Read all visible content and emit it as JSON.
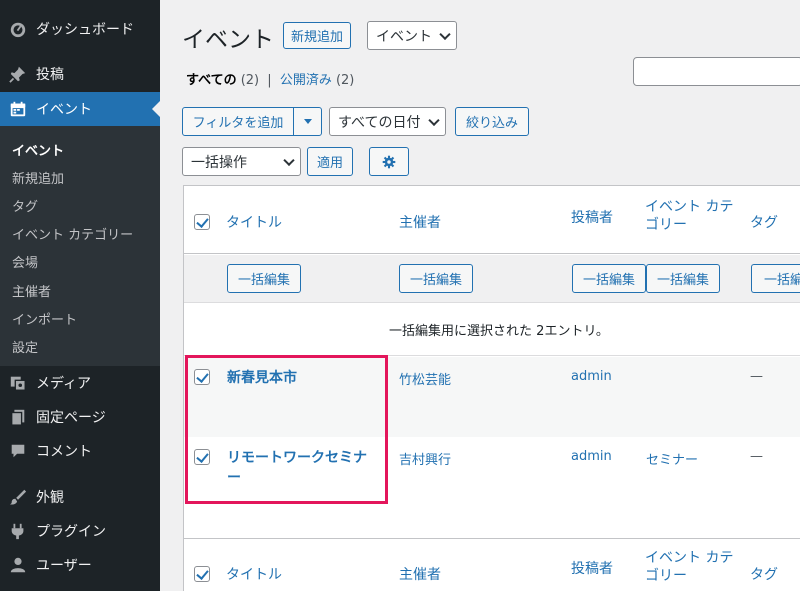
{
  "sidebar": {
    "dashboard": "ダッシュボード",
    "posts": "投稿",
    "events": "イベント",
    "submenu": [
      "イベント",
      "新規追加",
      "タグ",
      "イベント カテゴリー",
      "会場",
      "主催者",
      "インポート",
      "設定"
    ],
    "media": "メディア",
    "pages": "固定ページ",
    "comments": "コメント",
    "appearance": "外観",
    "plugins": "プラグイン",
    "users": "ユーザー"
  },
  "header": {
    "title": "イベント",
    "add_new": "新規追加",
    "type_select": "イベント"
  },
  "views": {
    "all_label": "すべての",
    "all_count": "(2)",
    "separator": "|",
    "published_label": "公開済み",
    "published_count": "(2)"
  },
  "filters": {
    "add_filter": "フィルタを追加",
    "date_select": "すべての日付",
    "filter_button": "絞り込み",
    "bulk_select": "一括操作",
    "apply": "適用"
  },
  "table": {
    "columns": {
      "title": "タイトル",
      "organizer": "主催者",
      "author": "投稿者",
      "category_line1": "イベント カテ",
      "category_line2": "ゴリー",
      "tags": "タグ"
    },
    "bulk_edit_label": "一括編集",
    "bulk_edit_cut": "一括編",
    "selection_notice": "一括編集用に選択された 2エントリ。",
    "rows": [
      {
        "title": "新春見本市",
        "organizer": "竹松芸能",
        "author": "admin",
        "category": "",
        "tags": "—"
      },
      {
        "title_line1": "リモートワークセミナ",
        "title_line2": "ー",
        "organizer": "吉村興行",
        "author": "admin",
        "category": "セミナー",
        "tags": "—"
      }
    ]
  },
  "colors": {
    "sidebar_bg": "#1d2327",
    "accent": "#2271b1",
    "highlight": "#e3165b"
  }
}
